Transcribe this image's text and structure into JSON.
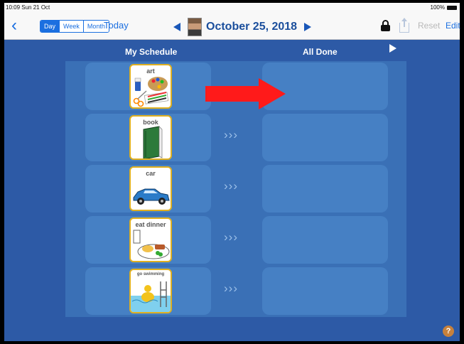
{
  "statusbar": {
    "time": "10:09  Sun 21 Oct",
    "battery": "100%"
  },
  "nav": {
    "back": "‹",
    "segments": [
      "Day",
      "Week",
      "Month"
    ],
    "active_segment": "Day",
    "today": "Today",
    "date": "October 25, 2018",
    "reset": "Reset",
    "edit": "Edit"
  },
  "columns": {
    "left": "My Schedule",
    "right": "All Done"
  },
  "chevrons": "›››",
  "schedule": [
    {
      "label": "art"
    },
    {
      "label": "book"
    },
    {
      "label": "car"
    },
    {
      "label": "eat dinner"
    },
    {
      "label": "go swimming"
    }
  ],
  "help": "?",
  "colors": {
    "accent": "#1b6fe0",
    "background": "#2d5aa6",
    "slot": "#4680c4",
    "card_border": "#e0b020",
    "arrow": "#ff1a1a"
  }
}
